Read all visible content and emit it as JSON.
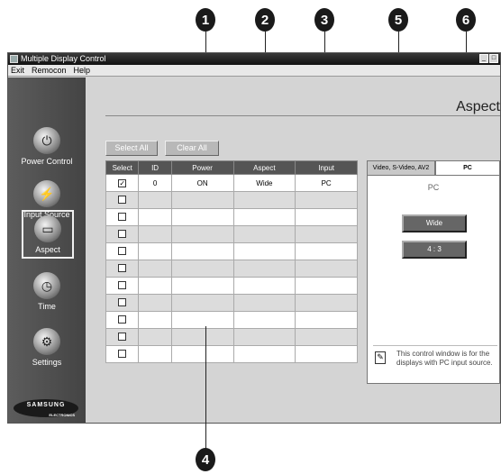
{
  "callouts": [
    "1",
    "2",
    "3",
    "4",
    "5",
    "6"
  ],
  "window": {
    "title": "Multiple Display Control",
    "menu": [
      "Exit",
      "Remocon",
      "Help"
    ]
  },
  "sidebar": {
    "items": [
      {
        "label": "Power Control",
        "icon": "power-icon"
      },
      {
        "label": "Input Source",
        "icon": "plug-icon"
      },
      {
        "label": "Aspect",
        "icon": "aspect-icon"
      },
      {
        "label": "Time",
        "icon": "clock-icon"
      },
      {
        "label": "Settings",
        "icon": "settings-icon"
      }
    ],
    "logo": "SAMSUNG",
    "logo_sub": "ELECTRONICS"
  },
  "page": {
    "title": "Aspect"
  },
  "toolbar": {
    "select_all": "Select All",
    "clear_all": "Clear All"
  },
  "table": {
    "columns": [
      "Select",
      "ID",
      "Power",
      "Aspect",
      "Input"
    ],
    "rows": [
      {
        "checked": true,
        "id": "0",
        "power": "ON",
        "aspect": "Wide",
        "input": "PC"
      },
      {
        "checked": false,
        "id": "",
        "power": "",
        "aspect": "",
        "input": ""
      },
      {
        "checked": false,
        "id": "",
        "power": "",
        "aspect": "",
        "input": ""
      },
      {
        "checked": false,
        "id": "",
        "power": "",
        "aspect": "",
        "input": ""
      },
      {
        "checked": false,
        "id": "",
        "power": "",
        "aspect": "",
        "input": ""
      },
      {
        "checked": false,
        "id": "",
        "power": "",
        "aspect": "",
        "input": ""
      },
      {
        "checked": false,
        "id": "",
        "power": "",
        "aspect": "",
        "input": ""
      },
      {
        "checked": false,
        "id": "",
        "power": "",
        "aspect": "",
        "input": ""
      },
      {
        "checked": false,
        "id": "",
        "power": "",
        "aspect": "",
        "input": ""
      },
      {
        "checked": false,
        "id": "",
        "power": "",
        "aspect": "",
        "input": ""
      },
      {
        "checked": false,
        "id": "",
        "power": "",
        "aspect": "",
        "input": ""
      }
    ]
  },
  "panel": {
    "tabs": [
      "Video, S-Video, AV2",
      "PC"
    ],
    "active_tab": "PC",
    "heading": "PC",
    "buttons": [
      "Wide",
      "4 : 3"
    ],
    "note": "This control window is for the displays with PC input source."
  }
}
